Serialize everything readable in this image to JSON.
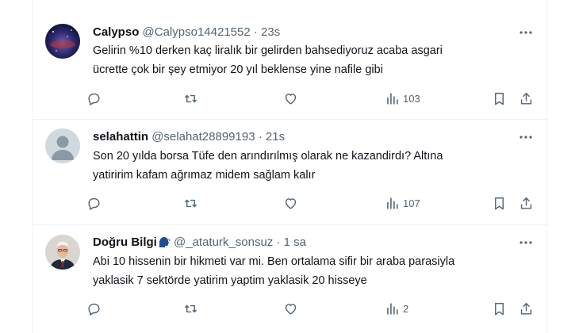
{
  "tweets": [
    {
      "name": "Calypso",
      "handle": "@Calypso14421552",
      "separator": "·",
      "time": "23s",
      "avatar_icon": "space-photo-avatar",
      "lines": [
        "Gelirin %10 derken kaç liralık bir gelirden bahsediyoruz acaba asgari",
        "ücrette çok bir şey etmiyor 20 yıl beklense yine nafile gibi"
      ],
      "views": "103"
    },
    {
      "name": "selahattin",
      "handle": "@selahat28899193",
      "separator": "·",
      "time": "21s",
      "avatar_icon": "default-profile-avatar",
      "lines": [
        "Son 20 yılda borsa Tüfe den arındırılmış olarak ne kazandirdı? Altına",
        "yatiririm kafam ağrımaz midem sağlam kalır"
      ],
      "views": "107"
    },
    {
      "name": "Doğru Bilgi",
      "handle": "@_ataturk_sonsuz",
      "separator": "·",
      "time": "1 sa",
      "avatar_icon": "man-portrait-avatar",
      "name_emoji": "speaking-head-icon",
      "lines": [
        "Abi 10 hissenin bir hikmeti var mi. Ben ortalama sifir bir araba parasiyla",
        "yaklasik 7 sektörde yatirim yaptim yaklasik 20 hisseye"
      ],
      "views": "2"
    }
  ],
  "colors": {
    "text_primary": "#0f1419",
    "text_secondary": "#536471",
    "divider": "#eff3f4"
  }
}
